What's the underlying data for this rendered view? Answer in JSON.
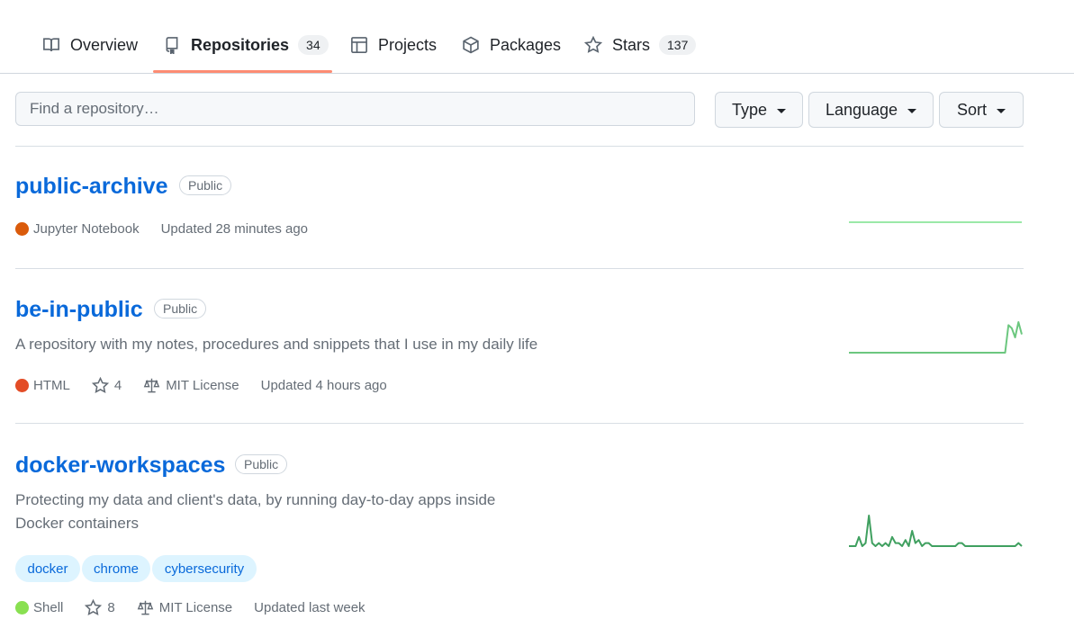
{
  "tabs": [
    {
      "label": "Overview",
      "icon": "book-icon"
    },
    {
      "label": "Repositories",
      "icon": "repo-icon",
      "count": "34",
      "active": true
    },
    {
      "label": "Projects",
      "icon": "table-icon"
    },
    {
      "label": "Packages",
      "icon": "package-icon"
    },
    {
      "label": "Stars",
      "icon": "star-icon",
      "count": "137"
    }
  ],
  "filters": {
    "search_placeholder": "Find a repository…",
    "type_label": "Type",
    "language_label": "Language",
    "sort_label": "Sort"
  },
  "repos": [
    {
      "name": "public-archive",
      "visibility": "Public",
      "language": "Jupyter Notebook",
      "language_color": "#DA5B0B",
      "updated": "Updated 28 minutes ago",
      "activity": [
        0,
        0,
        0,
        0,
        0,
        0,
        0,
        0,
        0,
        0,
        0,
        0,
        0,
        0,
        0,
        0,
        0,
        0,
        0,
        0,
        0,
        0,
        0,
        0,
        0,
        0,
        0,
        0,
        0,
        0,
        0,
        0,
        0,
        0,
        0,
        0,
        0,
        0,
        0,
        0,
        0,
        0,
        0,
        0,
        0,
        0,
        0,
        0,
        0,
        0,
        0,
        0,
        0
      ]
    },
    {
      "name": "be-in-public",
      "visibility": "Public",
      "description": "A repository with my notes, procedures and snippets that I use in my daily life",
      "language": "HTML",
      "language_color": "#e34c26",
      "stars": "4",
      "license": "MIT License",
      "updated": "Updated 4 hours ago",
      "activity": [
        0,
        0,
        0,
        0,
        0,
        0,
        0,
        0,
        0,
        0,
        0,
        0,
        0,
        0,
        0,
        0,
        0,
        0,
        0,
        0,
        0,
        0,
        0,
        0,
        0,
        0,
        0,
        0,
        0,
        0,
        0,
        0,
        0,
        0,
        0,
        0,
        0,
        0,
        0,
        0,
        0,
        0,
        0,
        0,
        0,
        0,
        0,
        0,
        9,
        8,
        5,
        10,
        6
      ]
    },
    {
      "name": "docker-workspaces",
      "visibility": "Public",
      "description": "Protecting my data and client's data, by running day-to-day apps inside Docker containers",
      "topics": [
        "docker",
        "chrome",
        "cybersecurity"
      ],
      "language": "Shell",
      "language_color": "#89e051",
      "stars": "8",
      "license": "MIT License",
      "updated": "Updated last week",
      "activity": [
        0,
        0,
        0,
        3,
        0,
        1,
        10,
        1,
        0,
        1,
        0,
        1,
        0,
        3,
        1,
        1,
        0,
        2,
        0,
        5,
        1,
        2,
        0,
        1,
        1,
        0,
        0,
        0,
        0,
        0,
        0,
        0,
        0,
        1,
        1,
        0,
        0,
        0,
        0,
        0,
        0,
        0,
        0,
        0,
        0,
        0,
        0,
        0,
        0,
        0,
        0,
        1,
        0
      ]
    }
  ],
  "colors": {
    "link": "#0969da",
    "tab_underline": "#fd8c73",
    "sparkline": "#6cc77f"
  }
}
